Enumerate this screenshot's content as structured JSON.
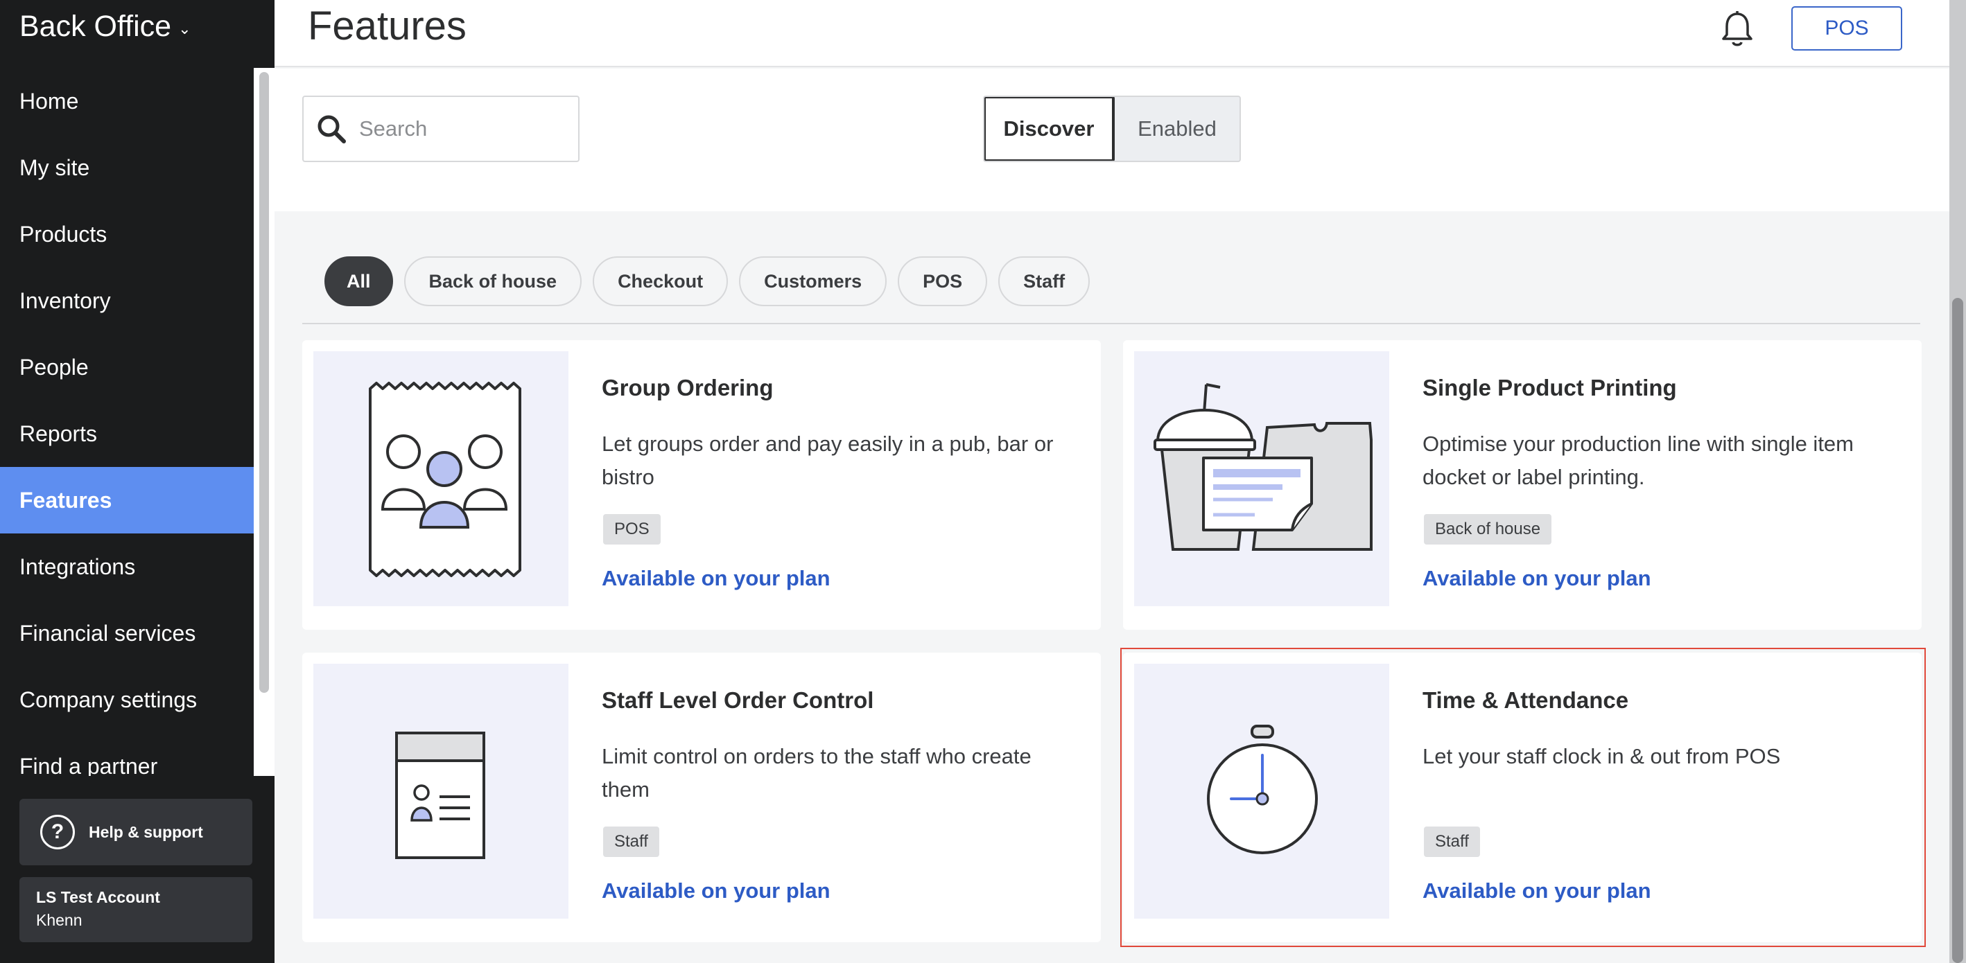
{
  "sidebar": {
    "app_title": "Back Office",
    "items": [
      {
        "label": "Home"
      },
      {
        "label": "My site"
      },
      {
        "label": "Products"
      },
      {
        "label": "Inventory"
      },
      {
        "label": "People"
      },
      {
        "label": "Reports"
      },
      {
        "label": "Features",
        "active": true
      },
      {
        "label": "Integrations"
      },
      {
        "label": "Financial services"
      },
      {
        "label": "Company settings"
      },
      {
        "label": "Find a partner"
      }
    ],
    "help_label": "Help & support",
    "account": {
      "name": "LS Test Account",
      "user": "Khenn"
    }
  },
  "header": {
    "title": "Features",
    "pos_button": "POS"
  },
  "toolbar": {
    "search_placeholder": "Search",
    "search_value": "",
    "tabs": {
      "discover": "Discover",
      "enabled": "Enabled",
      "selected": "Discover"
    }
  },
  "filters": {
    "chips": [
      "All",
      "Back of house",
      "Checkout",
      "Customers",
      "POS",
      "Staff"
    ],
    "selected": "All"
  },
  "cards": [
    {
      "title": "Group Ordering",
      "description": "Let groups order and pay easily in a pub, bar or bistro",
      "tag": "POS",
      "link": "Available on your plan",
      "icon": "group-receipt-illustration"
    },
    {
      "title": "Single Product Printing",
      "description": "Optimise your production line with single item docket or label printing.",
      "tag": "Back of house",
      "link": "Available on your plan",
      "icon": "printing-illustration"
    },
    {
      "title": "Staff Level Order Control",
      "description": "Limit control on orders to the staff who create them",
      "tag": "Staff",
      "link": "Available on your plan",
      "icon": "staff-badge-illustration"
    },
    {
      "title": "Time & Attendance",
      "description": "Let your staff clock in & out from POS",
      "tag": "Staff",
      "link": "Available on your plan",
      "icon": "stopwatch-illustration"
    }
  ],
  "colors": {
    "sidebar_bg": "#1b1c1d",
    "active_nav": "#5e8ef0",
    "link": "#2d5bc5",
    "highlight": "#e0483a",
    "illustration_accent": "#b8c2f2"
  }
}
